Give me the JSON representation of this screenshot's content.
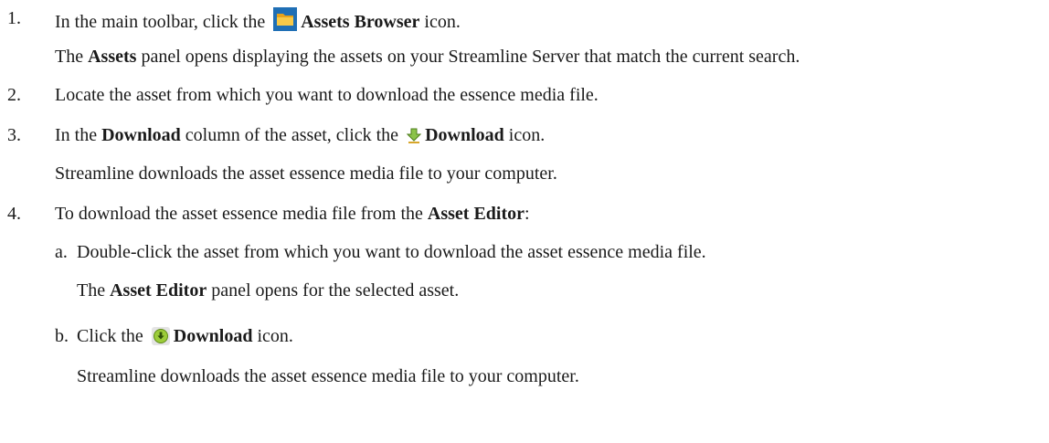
{
  "steps": [
    {
      "number": "1.",
      "parts": [
        "In the main toolbar, click the",
        "Assets Browser",
        "icon."
      ],
      "icon": "folder-icon",
      "result": [
        "The",
        "Assets",
        "panel opens displaying the assets on your Streamline Server that match the current search."
      ]
    },
    {
      "number": "2.",
      "text": "Locate the asset from which you want to download the essence media file."
    },
    {
      "number": "3.",
      "parts": [
        "In the",
        "Download",
        "column of the asset, click the",
        "Download",
        "icon."
      ],
      "icon": "download-arrow-icon",
      "result": "Streamline downloads the asset essence media file to your computer."
    },
    {
      "number": "4.",
      "parts": [
        "To download the asset essence media file from the",
        "Asset Editor",
        ":"
      ],
      "substeps": [
        {
          "letter": "a.",
          "text": "Double-click the asset from which you want to download the asset essence media file.",
          "result": [
            "The",
            "Asset Editor",
            "panel opens for the selected asset."
          ]
        },
        {
          "letter": "b.",
          "parts": [
            "Click the",
            "Download",
            "icon."
          ],
          "icon": "download-circle-icon",
          "result": "Streamline downloads the asset essence media file to your computer."
        }
      ]
    }
  ]
}
